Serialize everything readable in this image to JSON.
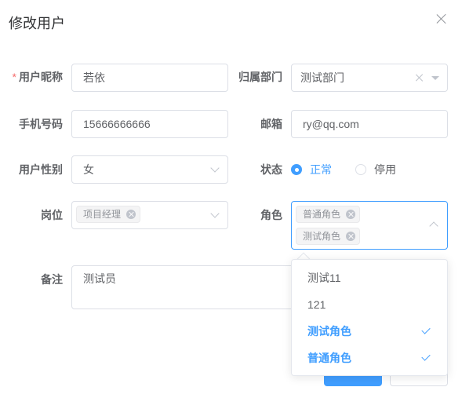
{
  "dialog": {
    "title": "修改用户"
  },
  "form": {
    "nickname": {
      "label": "用户昵称",
      "required_mark": "*",
      "value": "若依"
    },
    "dept": {
      "label": "归属部门",
      "value": "测试部门"
    },
    "phone": {
      "label": "手机号码",
      "value": "15666666666"
    },
    "email": {
      "label": "邮箱",
      "value": "ry@qq.com"
    },
    "gender": {
      "label": "用户性别",
      "value": "女"
    },
    "status": {
      "label": "状态",
      "options": [
        {
          "label": "正常",
          "checked": true
        },
        {
          "label": "停用",
          "checked": false
        }
      ]
    },
    "post": {
      "label": "岗位",
      "tags": [
        "项目经理"
      ]
    },
    "role": {
      "label": "角色",
      "tags": [
        "普通角色",
        "测试角色"
      ]
    },
    "remark": {
      "label": "备注",
      "value": "测试员"
    }
  },
  "role_dropdown": {
    "options": [
      {
        "label": "测试11",
        "selected": false
      },
      {
        "label": "121",
        "selected": false
      },
      {
        "label": "测试角色",
        "selected": true
      },
      {
        "label": "普通角色",
        "selected": true
      }
    ]
  },
  "colors": {
    "primary": "#409eff",
    "required": "#f56c6c",
    "border": "#dcdfe6"
  }
}
